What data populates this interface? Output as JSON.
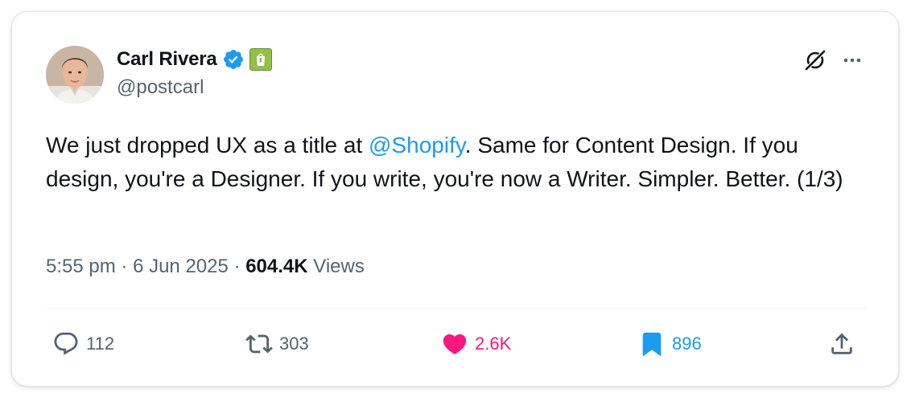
{
  "author": {
    "display_name": "Carl Rivera",
    "handle": "@postcarl",
    "verified": true,
    "affiliate_badge": "shopify-bag-icon"
  },
  "tweet": {
    "text_before_mention": "We just dropped UX as a title at ",
    "mention": "@Shopify",
    "text_after_mention": ". Same for Content Design. If you design, you're a Designer. If you write, you're now a Writer. Simpler. Better. (1/3)"
  },
  "meta": {
    "time": "5:55 pm",
    "separator": "·",
    "date": "6 Jun 2025",
    "views_count": "604.4K",
    "views_label": "Views"
  },
  "actions": {
    "reply_count": "112",
    "retweet_count": "303",
    "like_count": "2.6K",
    "bookmark_count": "896"
  },
  "colors": {
    "accent": "#1d9bf0",
    "like": "#f91880",
    "muted": "#536471",
    "text": "#0f1419",
    "shopify": "#95bf47"
  },
  "icons": [
    "verified-badge-icon",
    "shopify-bag-icon",
    "grok-icon",
    "more-icon",
    "reply-icon",
    "retweet-icon",
    "heart-icon",
    "bookmark-icon",
    "share-icon"
  ]
}
